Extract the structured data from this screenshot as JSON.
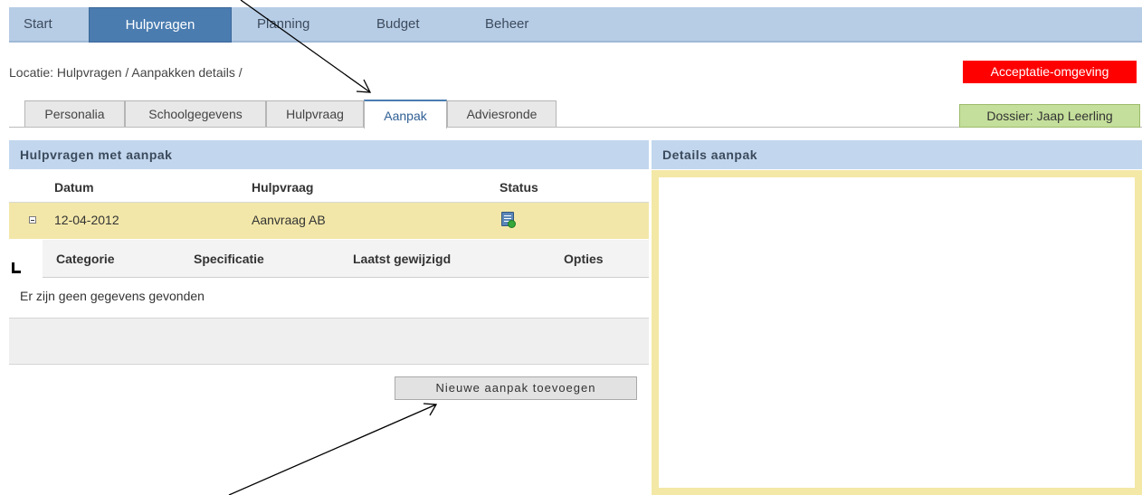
{
  "nav": {
    "items": [
      "Start",
      "Hulpvragen",
      "Planning",
      "Budget",
      "Beheer"
    ],
    "active": "Hulpvragen"
  },
  "breadcrumb": "Locatie: Hulpvragen / Aanpakken details /",
  "environment_badge": "Acceptatie-omgeving",
  "dossier_badge": "Dossier: Jaap Leerling",
  "tabs": [
    "Personalia",
    "Schoolgegevens",
    "Hulpvraag",
    "Aanpak",
    "Adviesronde"
  ],
  "active_tab": "Aanpak",
  "left_panel": {
    "title": "Hulpvragen met aanpak",
    "columns": [
      "Datum",
      "Hulpvraag",
      "Status"
    ],
    "rows": [
      {
        "datum": "12-04-2012",
        "hulpvraag": "Aanvraag AB",
        "status_icon": "document-add-icon"
      }
    ],
    "sub_columns": [
      "Categorie",
      "Specificatie",
      "Laatst gewijzigd",
      "Opties"
    ],
    "empty_message": "Er zijn geen gegevens gevonden",
    "add_button": "Nieuwe aanpak toevoegen"
  },
  "right_panel": {
    "title": "Details aanpak"
  },
  "colors": {
    "nav_bg": "#b7cde6",
    "nav_active": "#4a7cb0",
    "panel_header": "#c2d7ee",
    "selected_row": "#f2e7a9",
    "env_badge": "#ff0000",
    "dossier_badge": "#c4df9b"
  }
}
